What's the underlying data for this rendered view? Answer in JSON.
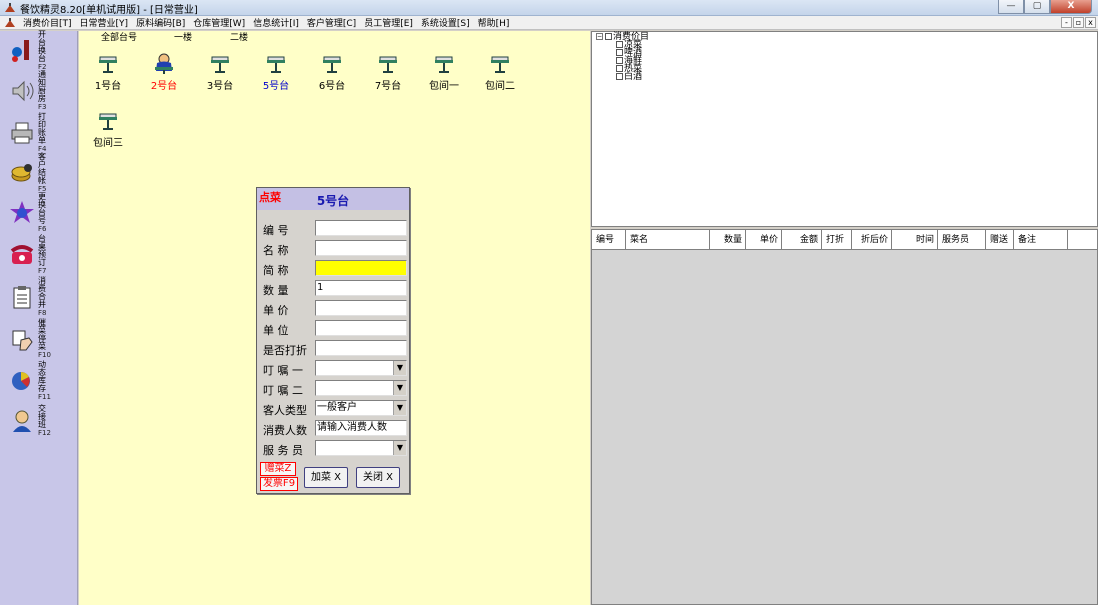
{
  "window": {
    "title": "餐饮精灵8.20[单机试用版] - [日常营业]",
    "controls": [
      "—",
      "▢",
      "X"
    ]
  },
  "menubar": {
    "items": [
      "消费价目[T]",
      "日常营业[Y]",
      "原料编码[B]",
      "仓库管理[W]",
      "信息统计[I]",
      "客户管理[C]",
      "员工管理[E]",
      "系统设置[S]",
      "帮助[H]"
    ],
    "mdi_controls": [
      "-",
      "▫",
      "x"
    ]
  },
  "toolbar": {
    "buttons": [
      {
        "label": "开台换台",
        "key": "F2",
        "icon": "open-table-icon"
      },
      {
        "label": "通知厨房",
        "key": "F3",
        "icon": "speaker-icon"
      },
      {
        "label": "打印账单",
        "key": "F4",
        "icon": "printer-icon"
      },
      {
        "label": "客户结帐",
        "key": "F5",
        "icon": "coins-icon"
      },
      {
        "label": "更换台号",
        "key": "F6",
        "icon": "swap-icon"
      },
      {
        "label": "台桌预订",
        "key": "F7",
        "icon": "phone-icon"
      },
      {
        "label": "消费合并",
        "key": "F8",
        "icon": "clipboard-icon"
      },
      {
        "label": "催菜停菜",
        "key": "F10",
        "icon": "hand-icon"
      },
      {
        "label": "动态库存",
        "key": "F11",
        "icon": "chart-icon"
      },
      {
        "label": "交接班",
        "key": "F12",
        "icon": "person-icon"
      }
    ]
  },
  "floor_tabs": [
    "全部台号",
    "一楼",
    "二楼"
  ],
  "tables": [
    {
      "name": "1号台",
      "status": "idle"
    },
    {
      "name": "2号台",
      "status": "occupied"
    },
    {
      "name": "3号台",
      "status": "idle"
    },
    {
      "name": "5号台",
      "status": "selected"
    },
    {
      "name": "6号台",
      "status": "idle"
    },
    {
      "name": "7号台",
      "status": "idle"
    },
    {
      "name": "包间一",
      "status": "idle"
    },
    {
      "name": "包间二",
      "status": "idle"
    },
    {
      "name": "包间三",
      "status": "idle"
    }
  ],
  "order_dialog": {
    "caption": "点菜",
    "title": "5号台",
    "fields": {
      "code": {
        "label": "编 号",
        "value": ""
      },
      "name": {
        "label": "名 称",
        "value": ""
      },
      "abbr": {
        "label": "简 称",
        "value": ""
      },
      "quantity": {
        "label": "数 量",
        "value": "1"
      },
      "price": {
        "label": "单 价",
        "value": ""
      },
      "unit": {
        "label": "单 位",
        "value": ""
      },
      "discount": {
        "label": "是否打折",
        "value": ""
      },
      "note1": {
        "label": "叮 嘱 一",
        "value": ""
      },
      "note2": {
        "label": "叮 嘱 二",
        "value": ""
      },
      "customer_type": {
        "label": "客人类型",
        "value": "一般客户"
      },
      "guests": {
        "label": "消费人数",
        "value": "请输入消费人数"
      },
      "waiter": {
        "label": "服 务 员",
        "value": ""
      }
    },
    "buttons": {
      "gift": "赠菜Z",
      "invoice": "发票F9",
      "add": "加菜 X",
      "close": "关闭 X"
    }
  },
  "menu_tree": {
    "root": "消费价目",
    "children": [
      "凉菜",
      "啤酒",
      "海鲜",
      "热菜",
      "白酒"
    ]
  },
  "order_grid": {
    "columns": [
      "编号",
      "菜名",
      "数量",
      "单价",
      "金额",
      "打折",
      "折后价",
      "时间",
      "服务员",
      "赠送",
      "备注"
    ]
  },
  "colors": {
    "table_area_bg": "#ffffc8",
    "toolbar_bg": "#c8c6e8",
    "occupied_text": "#ff0000",
    "selected_text": "#0000cc",
    "highlight_field": "#ffff00"
  }
}
